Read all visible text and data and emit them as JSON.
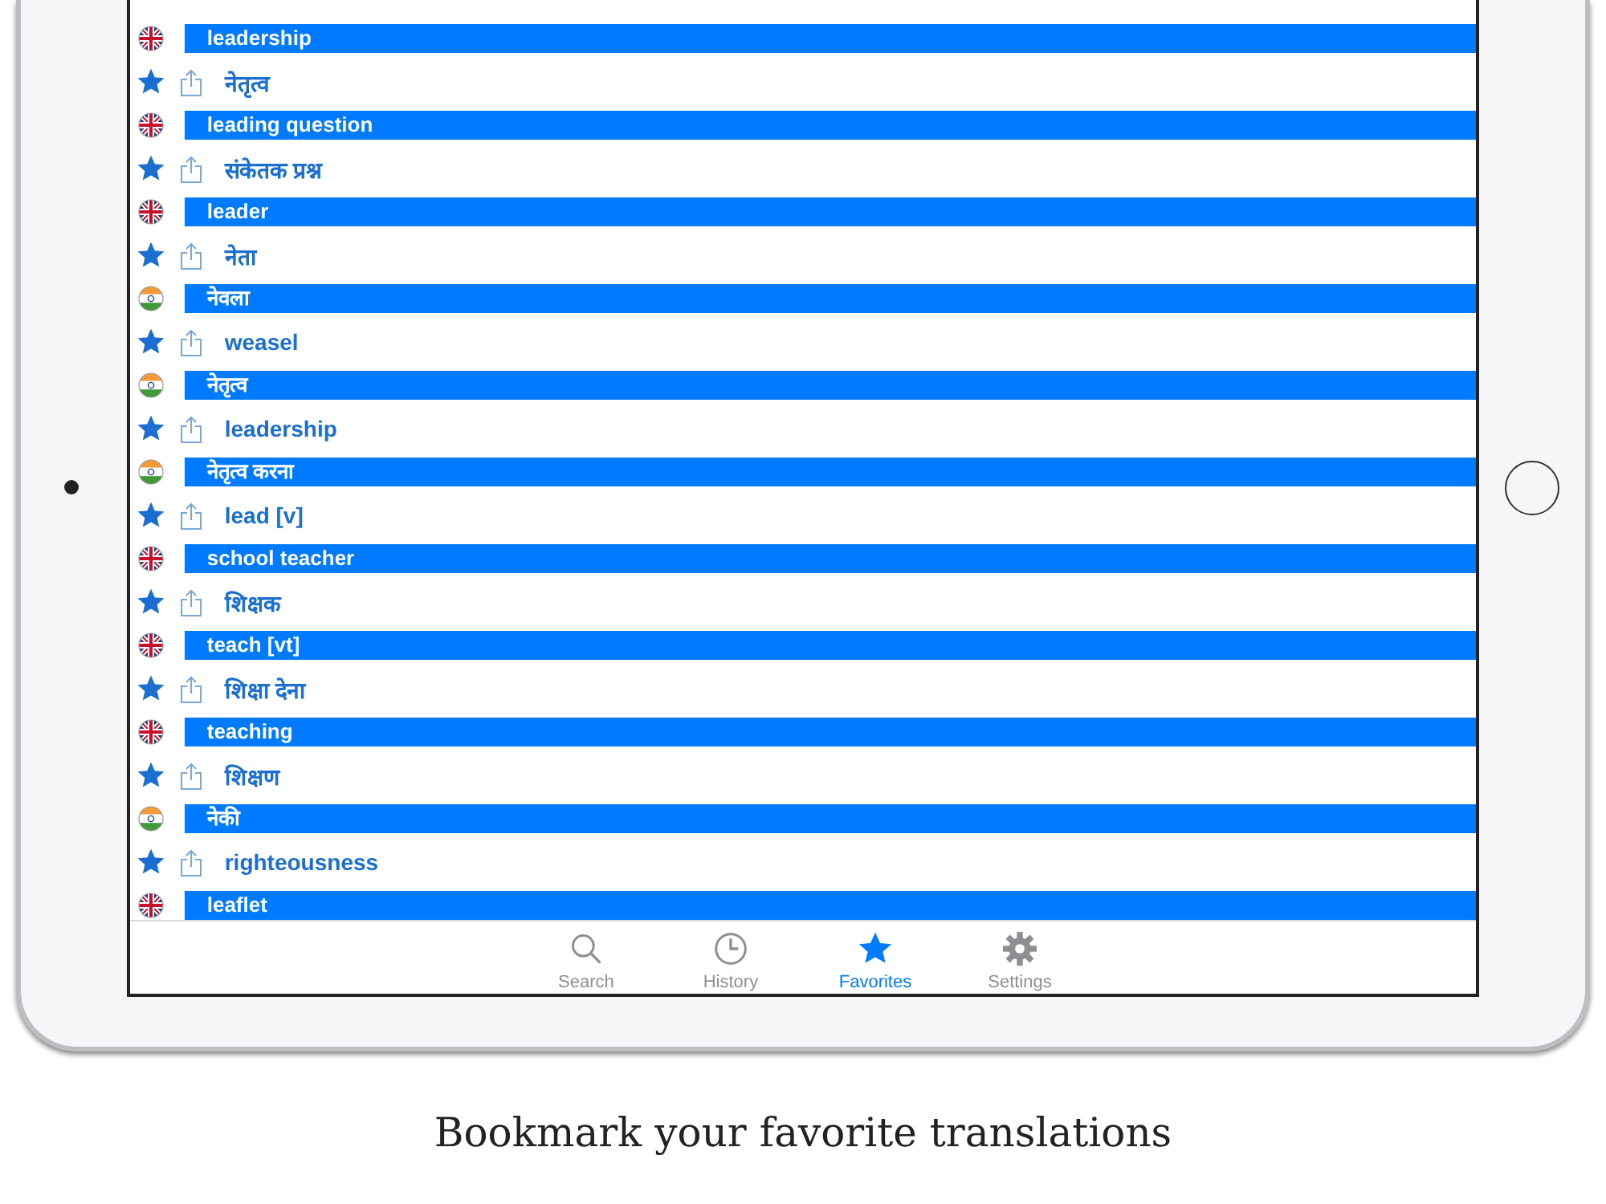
{
  "entries": [
    {
      "kind": "en",
      "term": "leadership",
      "translation": "नेतृत्व",
      "favorite": true
    },
    {
      "kind": "en",
      "term": "leading question",
      "translation": "संकेतक प्रश्न",
      "favorite": true
    },
    {
      "kind": "en",
      "term": "leader",
      "translation": "नेता",
      "favorite": true
    },
    {
      "kind": "hi",
      "term": "नेवला",
      "translation": "weasel",
      "favorite": true
    },
    {
      "kind": "hi",
      "term": "नेतृत्व",
      "translation": "leadership",
      "favorite": true
    },
    {
      "kind": "hi",
      "term": "नेतृत्व करना",
      "translation": "lead [v]",
      "favorite": true
    },
    {
      "kind": "en",
      "term": "school teacher",
      "translation": "शिक्षक",
      "favorite": true
    },
    {
      "kind": "en",
      "term": "teach [vt]",
      "translation": "शिक्षा देना",
      "favorite": true
    },
    {
      "kind": "en",
      "term": "teaching",
      "translation": "शिक्षण",
      "favorite": true
    },
    {
      "kind": "hi",
      "term": "नेकी",
      "translation": "righteousness",
      "favorite": true
    },
    {
      "kind": "en",
      "term": "leaflet"
    }
  ],
  "tabs": [
    {
      "kind": "search",
      "label": "Search",
      "selected": false
    },
    {
      "kind": "history",
      "label": "History",
      "selected": false
    },
    {
      "kind": "favorites",
      "label": "Favorites",
      "selected": true
    },
    {
      "kind": "settings",
      "label": "Settings",
      "selected": false
    }
  ],
  "caption": "Bookmark your favorite translations"
}
